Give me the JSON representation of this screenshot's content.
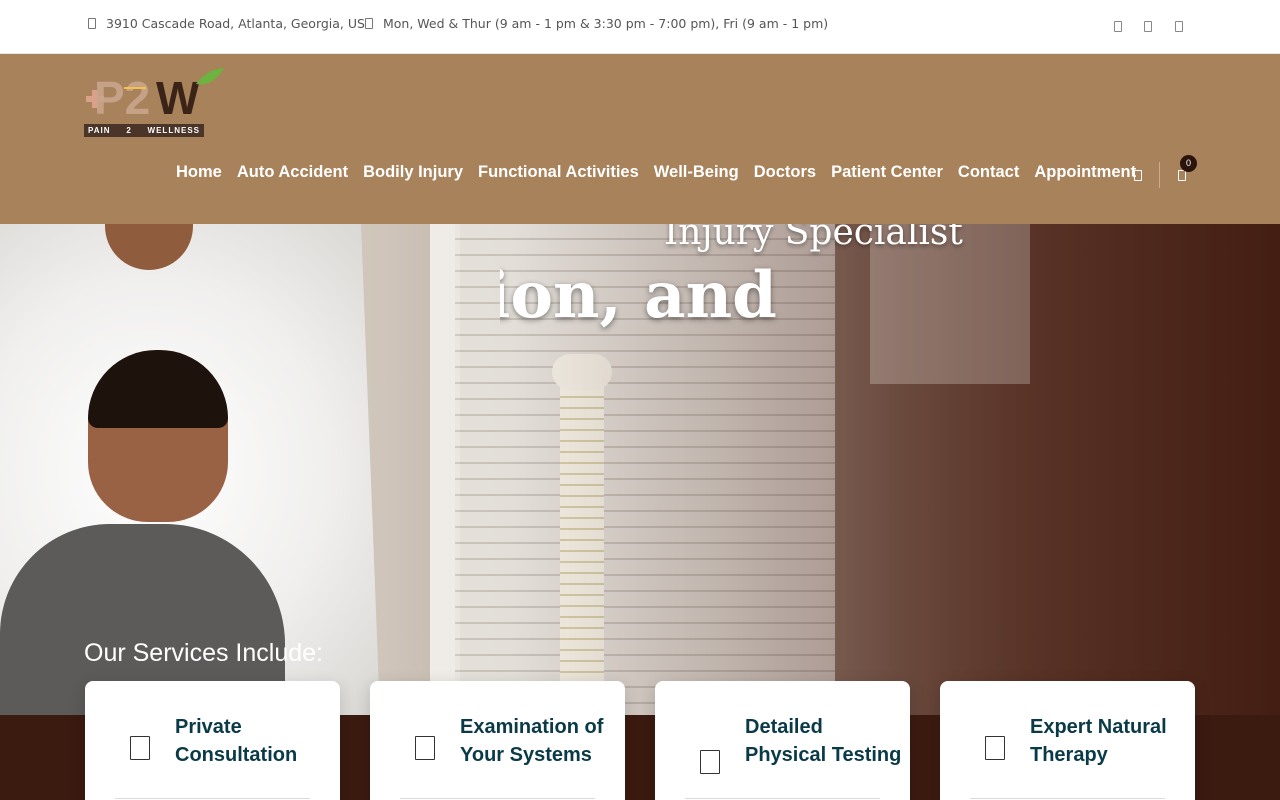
{
  "topbar": {
    "address": "3910 Cascade Road, Atlanta, Georgia, US",
    "hours": "Mon, Wed & Thur (9 am - 1 pm & 3:30 pm - 7:00 pm), Fri (9 am - 1 pm)",
    "icons": [
      "map-pin-icon",
      "clock-icon",
      "facebook-icon",
      "instagram-icon",
      "twitter-icon"
    ]
  },
  "header": {
    "logo": {
      "text": "P2W",
      "tagline_left": "PAIN",
      "tagline_mid": "2",
      "tagline_right": "WELLNESS"
    },
    "nav": [
      "Home",
      "Auto Accident",
      "Bodily Injury",
      "Functional Activities",
      "Well-Being",
      "Doctors",
      "Patient Center",
      "Contact",
      "Appointment"
    ],
    "cart_count": "0",
    "colors": {
      "header_bg": "#a8825a",
      "accent_dark": "#3b1a10",
      "card_title": "#0a3a47"
    }
  },
  "hero": {
    "subtitle": "Injury Specialist",
    "title": "ion, and",
    "services_heading": "Our Services Include:"
  },
  "services": [
    {
      "title": "Private Consultation"
    },
    {
      "title": "Examination of Your Systems"
    },
    {
      "title": "Detailed Physical Testing"
    },
    {
      "title": "Expert Natural Therapy"
    }
  ]
}
